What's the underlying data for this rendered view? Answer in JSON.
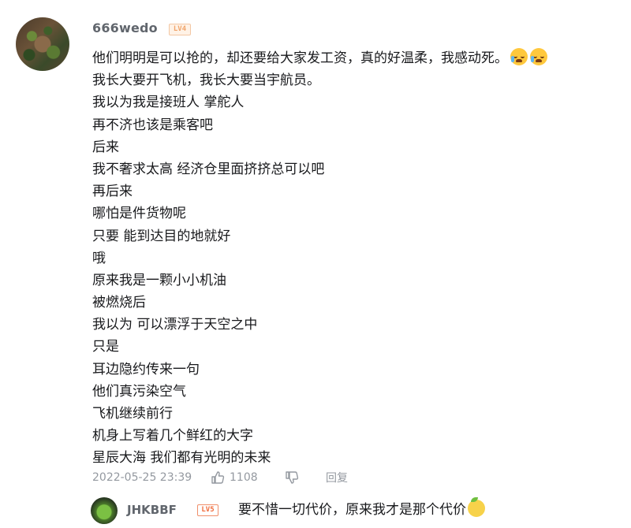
{
  "comment": {
    "username": "666wedo",
    "level": "LV4",
    "lines": [
      "他们明明是可以抢的，却还要给大家发工资，真的好温柔，我感动死。",
      "我长大要开飞机，我长大要当宇航员。",
      "我以为我是接班人 掌舵人",
      "再不济也该是乘客吧",
      "后来",
      "我不奢求太高 经济仓里面挤挤总可以吧",
      "再后来",
      "哪怕是件货物呢",
      "只要 能到达目的地就好",
      "哦",
      "原来我是一颗小小机油",
      "被燃烧后",
      "我以为 可以漂浮于天空之中",
      "只是",
      "耳边隐约传来一句",
      "他们真污染空气",
      "飞机继续前行",
      "机身上写着几个鲜红的大字",
      "星辰大海 我们都有光明的未来"
    ],
    "timestamp": "2022-05-25 23:39",
    "likes": "1108",
    "reply_label": "回复"
  },
  "reply": {
    "username": "JHKBBF",
    "level": "LV5",
    "text": "要不惜一切代价，原来我才是那个代价"
  }
}
